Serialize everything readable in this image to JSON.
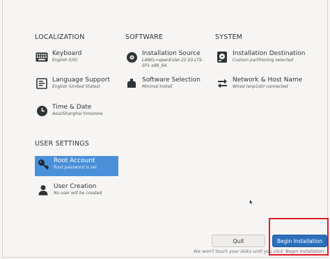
{
  "sections": {
    "localization": "LOCALIZATION",
    "software": "SOFTWARE",
    "system": "SYSTEM",
    "user_settings": "USER SETTINGS"
  },
  "spokes": {
    "keyboard": {
      "title": "Keyboard",
      "status": "English (US)",
      "icon": "keyboard-icon"
    },
    "language": {
      "title": "Language Support",
      "status": "English (United States)",
      "icon": "language-icon"
    },
    "time": {
      "title": "Time & Date",
      "status": "Asia/Shanghai timezone",
      "icon": "clock-icon"
    },
    "source": {
      "title": "Installation Source",
      "status_lines": [
        "LABEL=openEuler-22.03-LTS-",
        "SP1-x86_64."
      ],
      "icon": "disc-icon"
    },
    "software": {
      "title": "Software Selection",
      "status": "Minimal Install",
      "icon": "package-icon"
    },
    "destination": {
      "title": "Installation Destination",
      "status": "Custom partitioning selected",
      "icon": "hard-disk-icon"
    },
    "network": {
      "title": "Network & Host Name",
      "status": "Wired (enp1s0) connected",
      "icon": "network-arrows-icon"
    },
    "root": {
      "title": "Root Account",
      "status": "Root password is set",
      "icon": "key-icon"
    },
    "user": {
      "title": "User Creation",
      "status": "No user will be created",
      "icon": "user-icon"
    }
  },
  "buttons": {
    "quit": "Quit",
    "begin": "Begin Installation"
  },
  "footnote": "We won't touch your disks until you click 'Begin Installation'.",
  "colors": {
    "selected_bg": "#4a90d9",
    "begin_bg": "#2c6fbd",
    "highlight_border": "#e01b24"
  }
}
